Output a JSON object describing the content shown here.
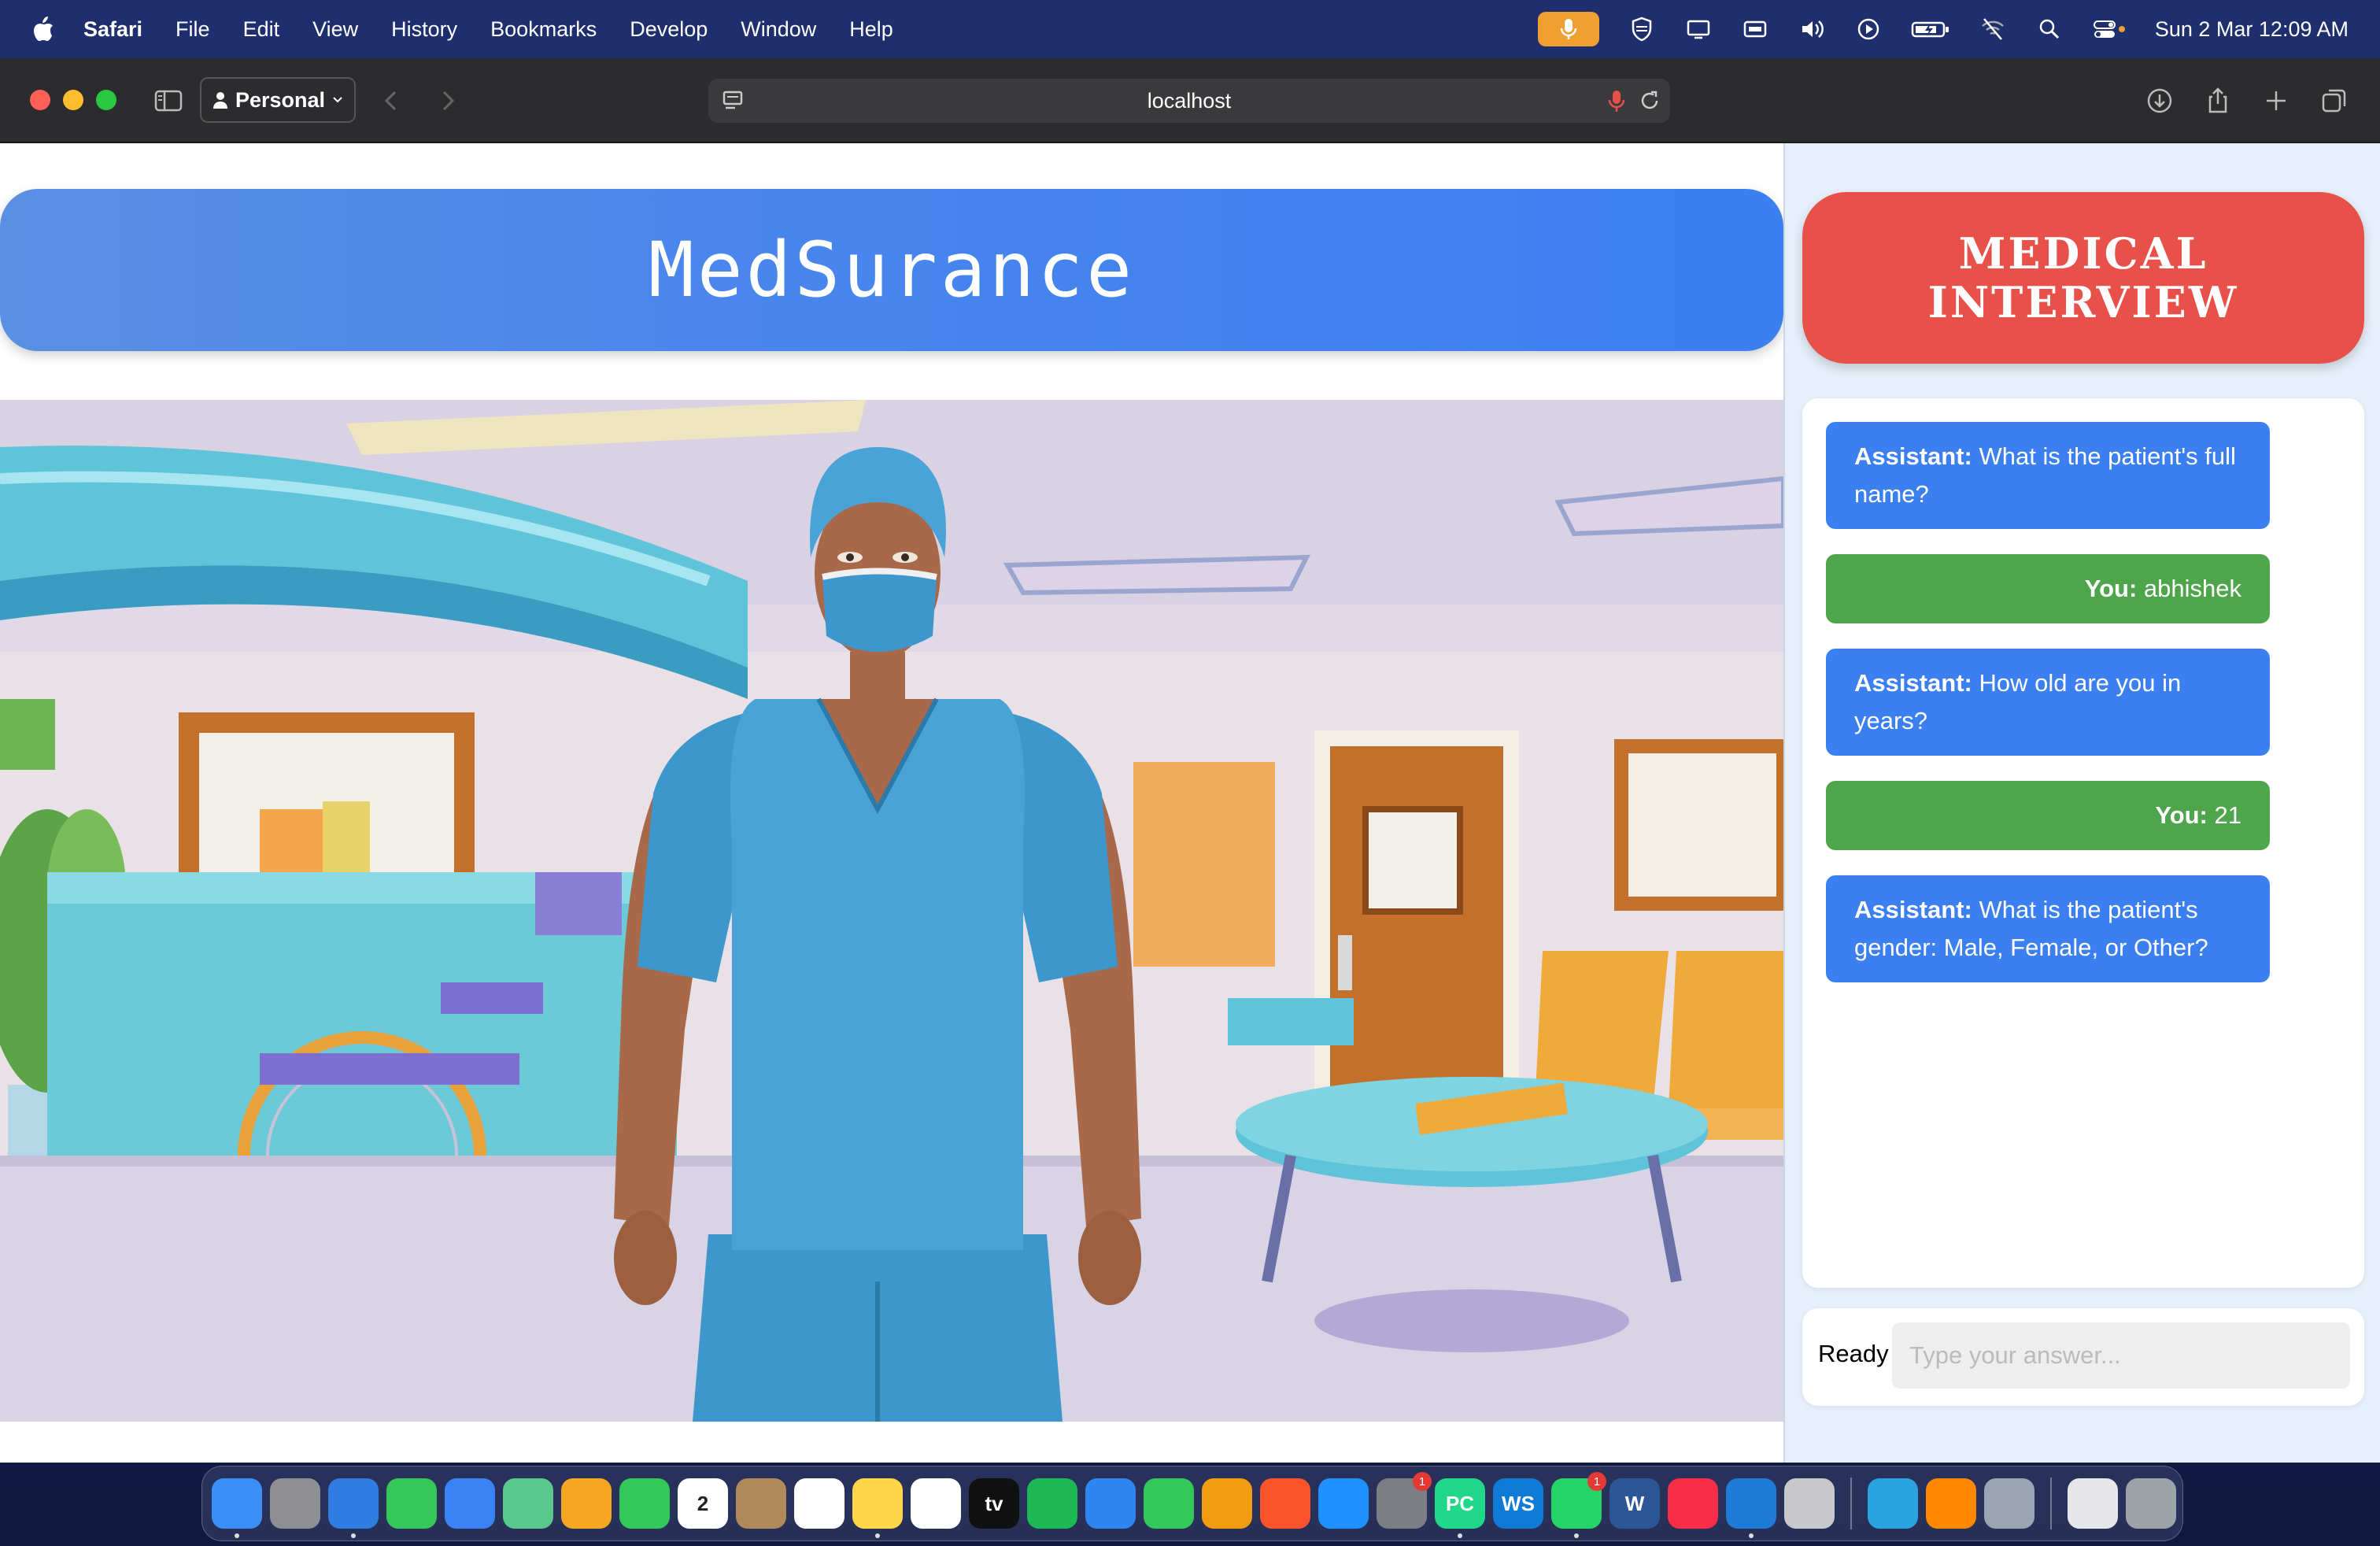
{
  "menubar": {
    "app_name": "Safari",
    "items": [
      "File",
      "Edit",
      "View",
      "History",
      "Bookmarks",
      "Develop",
      "Window",
      "Help"
    ],
    "clock": "Sun 2 Mar  12:09 AM",
    "accent_mic": "#f0a030"
  },
  "toolbar": {
    "profile_label": "Personal",
    "url": "localhost"
  },
  "header": {
    "title": "MedSurance",
    "color": "#3b7ff0"
  },
  "sidebar": {
    "title": "MEDICAL INTERVIEW",
    "title_color": "#e8504a",
    "messages": [
      {
        "role": "assistant",
        "speaker": "Assistant:",
        "text": "What is the patient's full name?"
      },
      {
        "role": "user",
        "speaker": "You:",
        "text": "abhishek"
      },
      {
        "role": "assistant",
        "speaker": "Assistant:",
        "text": "How old are you in years?"
      },
      {
        "role": "user",
        "speaker": "You:",
        "text": "21"
      },
      {
        "role": "assistant",
        "speaker": "Assistant:",
        "text": "What is the patient's gender: Male, Female, or Other?"
      }
    ],
    "status": "Ready",
    "input_placeholder": "Type your answer...",
    "assistant_color": "#3b7ff0",
    "user_color": "#4ea54c"
  },
  "dock": {
    "apps": [
      {
        "name": "finder-icon",
        "color": "#3a8ef6"
      },
      {
        "name": "launchpad-icon",
        "color": "#8e8e93"
      },
      {
        "name": "safari-icon",
        "color": "#2f7de1"
      },
      {
        "name": "messages-icon",
        "color": "#35c759"
      },
      {
        "name": "mail-icon",
        "color": "#3b82f6"
      },
      {
        "name": "maps-icon",
        "color": "#5ac88a"
      },
      {
        "name": "photos-icon",
        "color": "#f5a623"
      },
      {
        "name": "facetime-icon",
        "color": "#34c759"
      },
      {
        "name": "calendar-icon",
        "color": "#ffffff",
        "glyph": "2"
      },
      {
        "name": "contacts-icon",
        "color": "#b08a5a"
      },
      {
        "name": "reminders-icon",
        "color": "#ffffff"
      },
      {
        "name": "notes-icon",
        "color": "#ffd54a"
      },
      {
        "name": "freeform-icon",
        "color": "#ffffff"
      },
      {
        "name": "apple-tv-icon",
        "color": "#111111",
        "glyph": "tv"
      },
      {
        "name": "spotify-icon",
        "color": "#1db954"
      },
      {
        "name": "keynote-icon",
        "color": "#2e86f0"
      },
      {
        "name": "numbers-icon",
        "color": "#34c759"
      },
      {
        "name": "pages-icon",
        "color": "#f39c12"
      },
      {
        "name": "brave-icon",
        "color": "#fb542b"
      },
      {
        "name": "app-store-icon",
        "color": "#1e90ff"
      },
      {
        "name": "system-settings-icon",
        "color": "#7d7d85",
        "badge": "1"
      },
      {
        "name": "pycharm-icon",
        "color": "#21d789",
        "glyph": "PC"
      },
      {
        "name": "webstorm-icon",
        "color": "#0f7bd6",
        "glyph": "WS"
      },
      {
        "name": "whatsapp-icon",
        "color": "#25d366",
        "badge": "1"
      },
      {
        "name": "word-icon",
        "color": "#2b5797",
        "glyph": "W"
      },
      {
        "name": "music-icon",
        "color": "#fa2d48"
      },
      {
        "name": "vscode-icon",
        "color": "#1f7bd8"
      },
      {
        "name": "script-editor-icon",
        "color": "#c7c7cc"
      },
      {
        "name": "telegram-icon",
        "color": "#2aa3e0"
      },
      {
        "name": "vlc-icon",
        "color": "#ff8800"
      },
      {
        "name": "preview-icon",
        "color": "#9aa4b2"
      },
      {
        "name": "document-icon",
        "color": "#e7e7ea"
      },
      {
        "name": "trash-icon",
        "color": "#9ea3aa"
      }
    ]
  }
}
